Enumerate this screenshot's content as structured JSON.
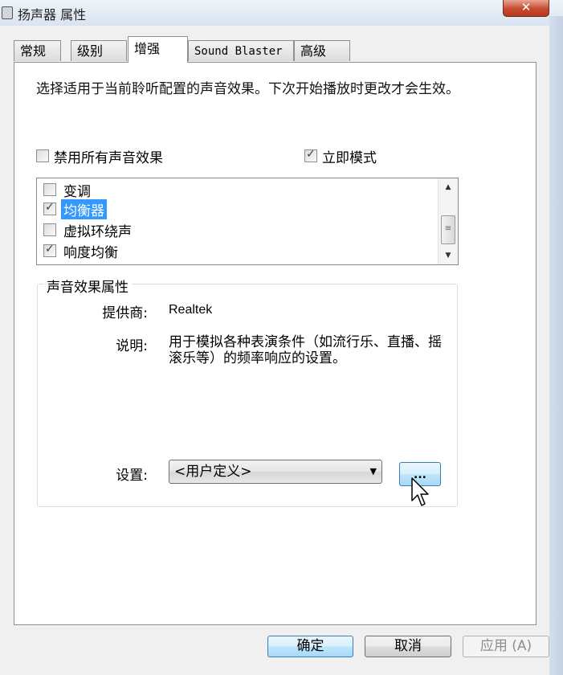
{
  "window": {
    "title": "扬声器 属性",
    "close_label": "✕"
  },
  "tabs": [
    {
      "label": "常规"
    },
    {
      "label": "级别"
    },
    {
      "label": "增强"
    },
    {
      "label": "Sound Blaster"
    },
    {
      "label": "高级"
    }
  ],
  "description": "选择适用于当前聆听配置的声音效果。下次开始播放时更改才会生效。",
  "disable_all": {
    "label": "禁用所有声音效果",
    "checked": false
  },
  "immediate_mode": {
    "label": "立即模式",
    "checked": true
  },
  "effects": [
    {
      "label": "变调",
      "checked": false,
      "selected": false
    },
    {
      "label": "均衡器",
      "checked": true,
      "selected": true
    },
    {
      "label": "虚拟环绕声",
      "checked": false,
      "selected": false
    },
    {
      "label": "响度均衡",
      "checked": true,
      "selected": false
    }
  ],
  "properties": {
    "group_title": "声音效果属性",
    "provider_label": "提供商:",
    "provider_value": "Realtek",
    "desc_label": "说明:",
    "desc_value": "用于模拟各种表演条件（如流行乐、直播、摇滚乐等）的频率响应的设置。",
    "setting_label": "设置:",
    "setting_value": "<用户定义>",
    "more_button": "..."
  },
  "buttons": {
    "ok": "确定",
    "cancel": "取消",
    "apply": "应用 (A)"
  }
}
